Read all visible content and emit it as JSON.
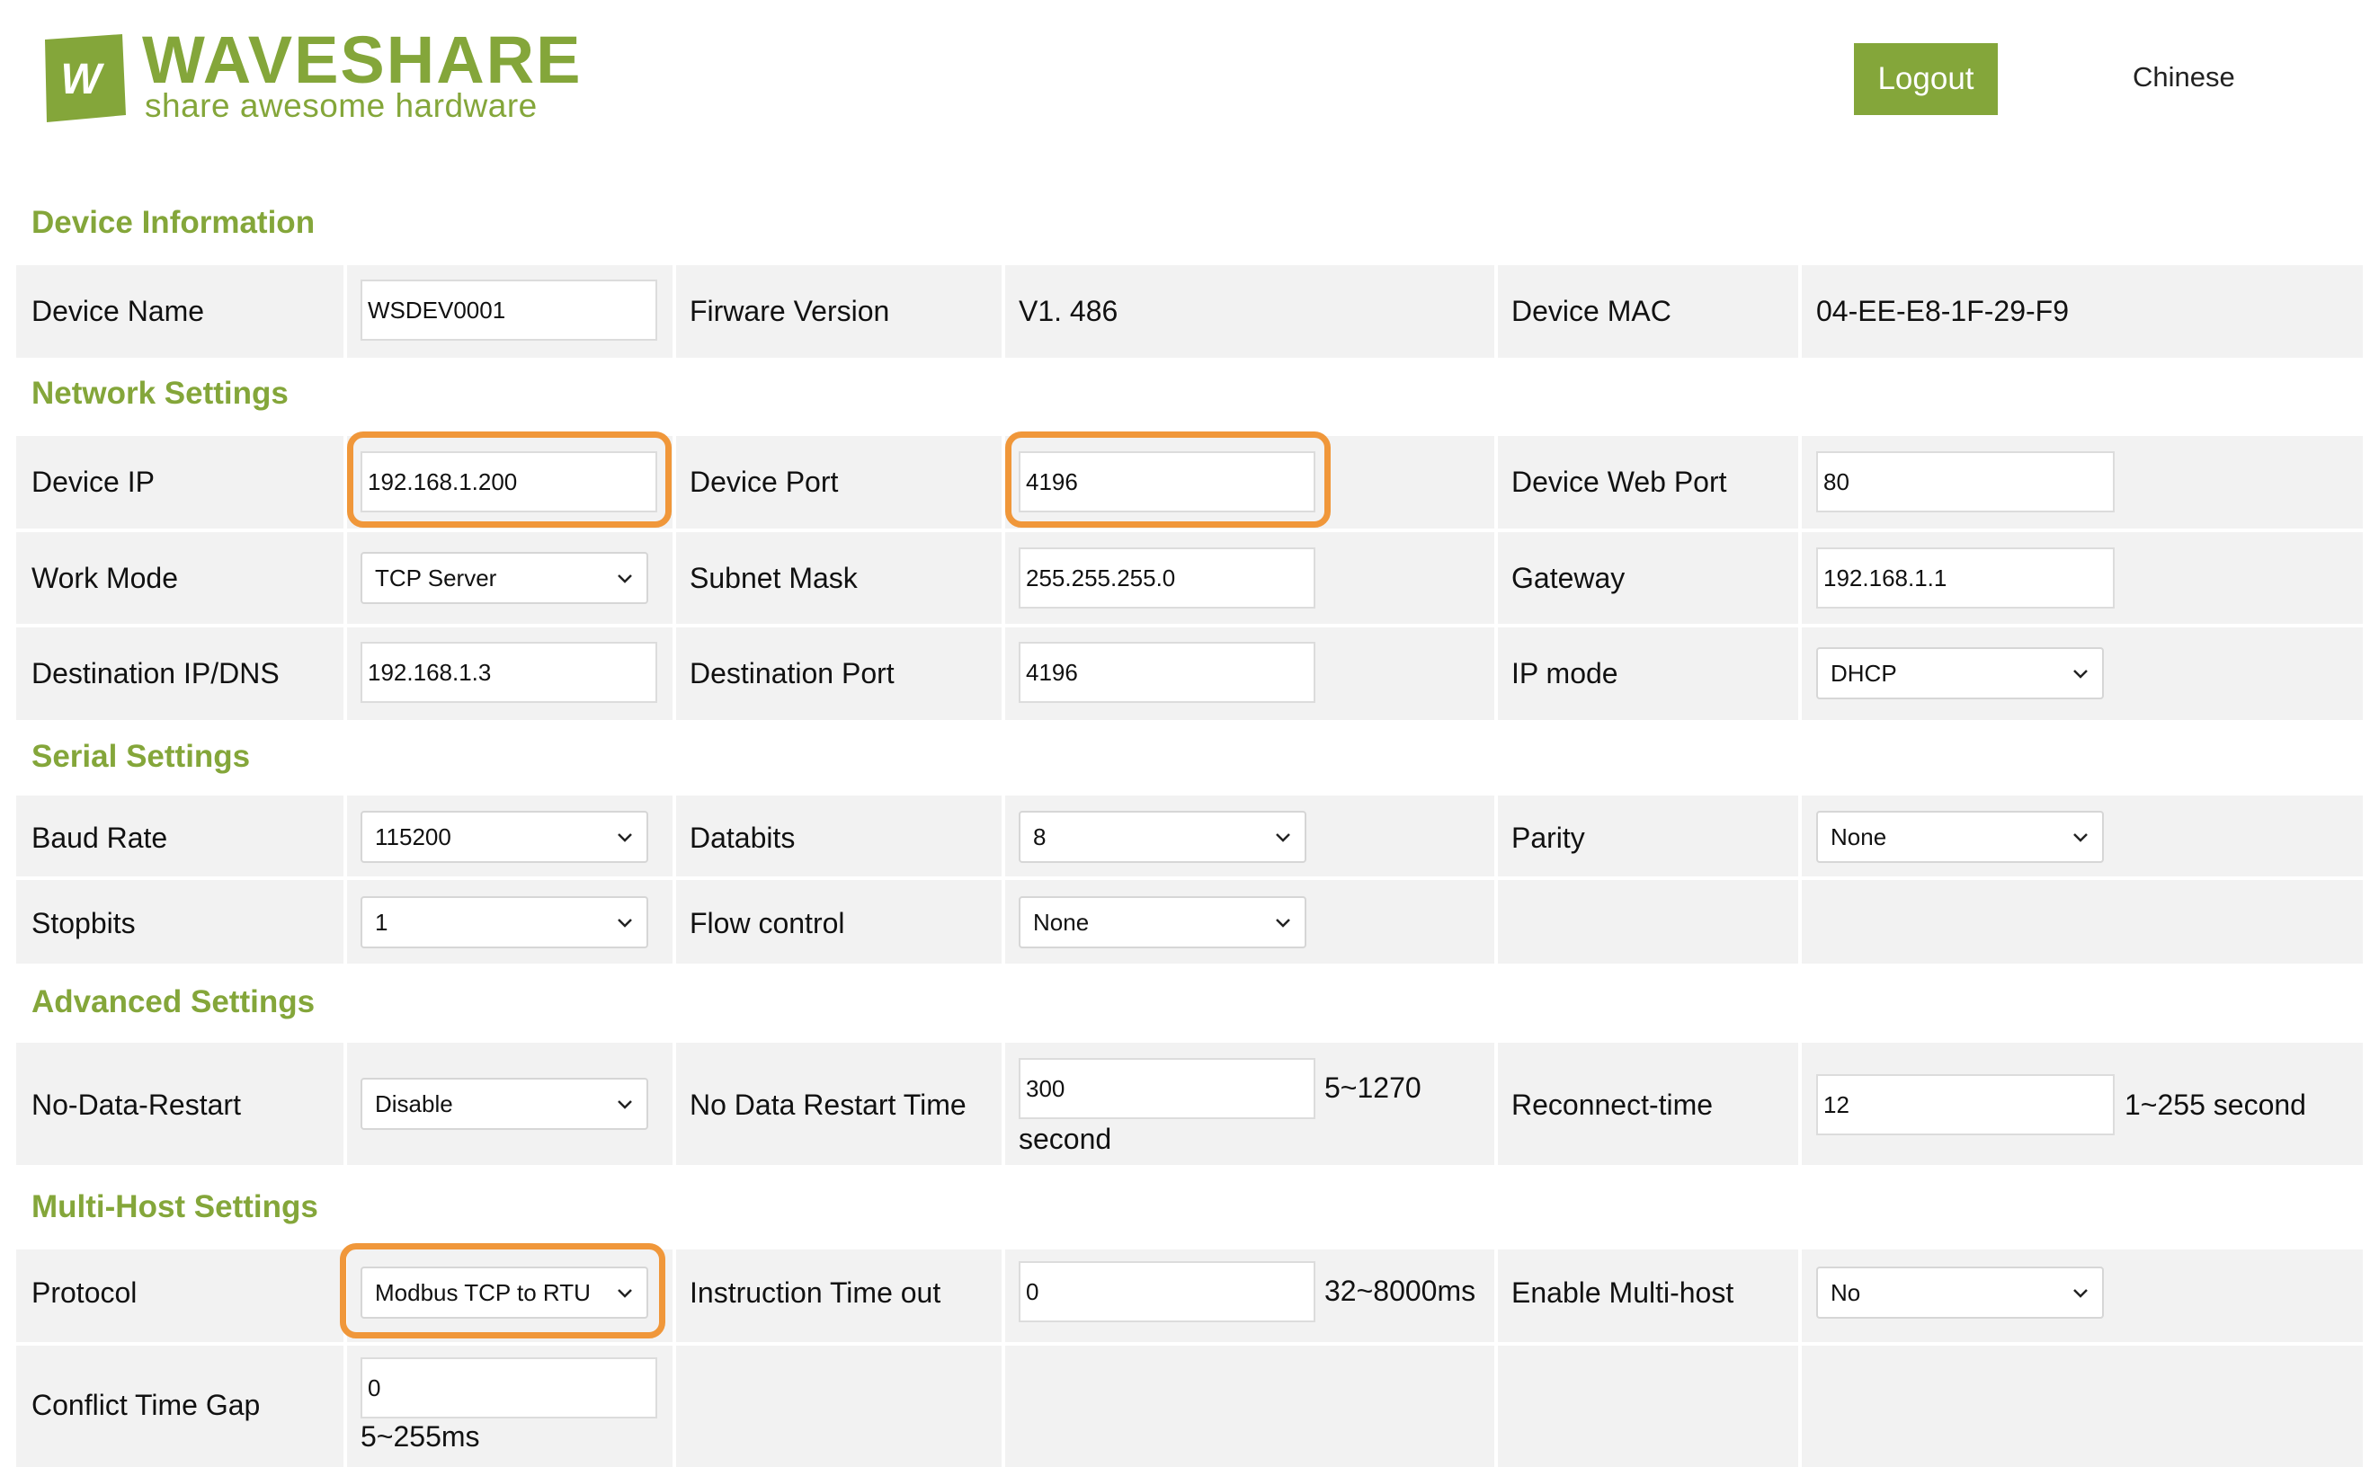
{
  "header": {
    "logo_word": "WAVESHARE",
    "logo_tagline": "share awesome hardware",
    "logout_label": "Logout",
    "language_label": "Chinese"
  },
  "colors": {
    "brand_green": "#84a63a",
    "highlight_orange": "#f0973a",
    "cell_bg": "#f2f2f2"
  },
  "device_info": {
    "title": "Device Information",
    "device_name_label": "Device Name",
    "device_name_value": "WSDEV0001",
    "firmware_label": "Firware Version",
    "firmware_value": "V1. 486",
    "mac_label": "Device MAC",
    "mac_value": "04-EE-E8-1F-29-F9"
  },
  "network": {
    "title": "Network Settings",
    "device_ip_label": "Device IP",
    "device_ip_value": "192.168.1.200",
    "device_port_label": "Device Port",
    "device_port_value": "4196",
    "web_port_label": "Device Web Port",
    "web_port_value": "80",
    "work_mode_label": "Work Mode",
    "work_mode_value": "TCP Server",
    "subnet_label": "Subnet Mask",
    "subnet_value": "255.255.255.0",
    "gateway_label": "Gateway",
    "gateway_value": "192.168.1.1",
    "dest_ip_label": "Destination IP/DNS",
    "dest_ip_value": "192.168.1.3",
    "dest_port_label": "Destination Port",
    "dest_port_value": "4196",
    "ip_mode_label": "IP mode",
    "ip_mode_value": "DHCP"
  },
  "serial": {
    "title": "Serial Settings",
    "baud_label": "Baud Rate",
    "baud_value": "115200",
    "databits_label": "Databits",
    "databits_value": "8",
    "parity_label": "Parity",
    "parity_value": "None",
    "stopbits_label": "Stopbits",
    "stopbits_value": "1",
    "flow_label": "Flow control",
    "flow_value": "None"
  },
  "advanced": {
    "title": "Advanced Settings",
    "no_data_restart_label": "No-Data-Restart",
    "no_data_restart_value": "Disable",
    "no_data_time_label": "No Data Restart Time",
    "no_data_time_value": "300",
    "no_data_time_hint": "5~1270",
    "no_data_time_unit": "second",
    "reconnect_label": "Reconnect-time",
    "reconnect_value": "12",
    "reconnect_hint": "1~255 second"
  },
  "multihost": {
    "title": "Multi-Host Settings",
    "protocol_label": "Protocol",
    "protocol_value": "Modbus TCP to RTU",
    "instruction_label": "Instruction Time out",
    "instruction_value": "0",
    "instruction_hint": "32~8000ms",
    "enable_label": "Enable Multi-host",
    "enable_value": "No",
    "conflict_label": "Conflict Time Gap",
    "conflict_value": "0",
    "conflict_hint": "5~255ms"
  }
}
